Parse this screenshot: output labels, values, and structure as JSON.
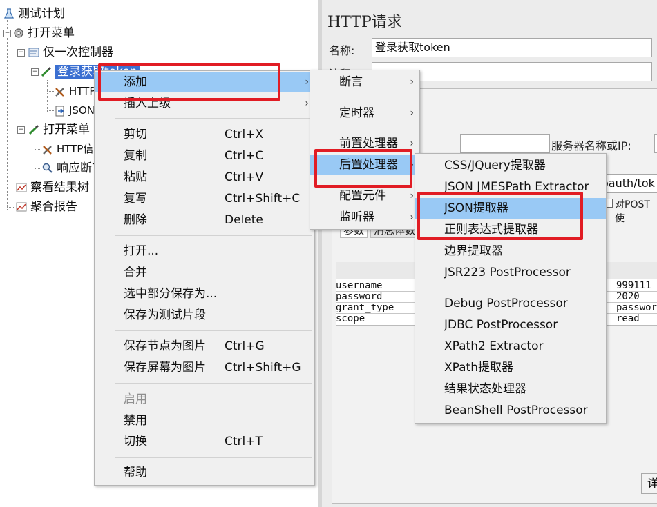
{
  "tree": {
    "nodes": [
      {
        "label": "测试计划"
      },
      {
        "label": "打开菜单"
      },
      {
        "label": "仅一次控制器"
      },
      {
        "label": "登录获取token"
      },
      {
        "label": "HTTP信息头管理器"
      },
      {
        "label": "JSON"
      },
      {
        "label": "打开菜单"
      },
      {
        "label": "HTTP信息头管理器"
      },
      {
        "label": "响应断言"
      },
      {
        "label": "察看结果树"
      },
      {
        "label": "聚合报告"
      }
    ]
  },
  "panel": {
    "title": "HTTP请求",
    "name_label": "名称:",
    "name_value": "登录获取token",
    "comment_label": "注释:",
    "server_label": "服务器名称或IP:",
    "path_value": "oauth/tok",
    "post_label": "对POST使",
    "params_tab": "参数",
    "body_tab": "消息体数",
    "params": [
      {
        "name": "username",
        "value": "999111"
      },
      {
        "name": "password",
        "value": "2020"
      },
      {
        "name": "grant_type",
        "value": "passwor"
      },
      {
        "name": "scope",
        "value": "read"
      }
    ],
    "detail_btn": "详"
  },
  "menu1": {
    "items": [
      {
        "label": "添加",
        "shortcut": "",
        "arrow": "›"
      },
      {
        "label": "插入上级",
        "shortcut": "",
        "arrow": "›"
      },
      {
        "label": "剪切",
        "shortcut": "Ctrl+X"
      },
      {
        "label": "复制",
        "shortcut": "Ctrl+C"
      },
      {
        "label": "粘贴",
        "shortcut": "Ctrl+V"
      },
      {
        "label": "复写",
        "shortcut": "Ctrl+Shift+C"
      },
      {
        "label": "删除",
        "shortcut": "Delete"
      },
      {
        "label": "打开...",
        "shortcut": ""
      },
      {
        "label": "合并",
        "shortcut": ""
      },
      {
        "label": "选中部分保存为...",
        "shortcut": ""
      },
      {
        "label": "保存为测试片段",
        "shortcut": ""
      },
      {
        "label": "保存节点为图片",
        "shortcut": "Ctrl+G"
      },
      {
        "label": "保存屏幕为图片",
        "shortcut": "Ctrl+Shift+G"
      },
      {
        "label": "启用",
        "shortcut": ""
      },
      {
        "label": "禁用",
        "shortcut": ""
      },
      {
        "label": "切换",
        "shortcut": "Ctrl+T"
      },
      {
        "label": "帮助",
        "shortcut": ""
      }
    ]
  },
  "menu2": {
    "items": [
      {
        "label": "断言",
        "arrow": "›"
      },
      {
        "label": "定时器",
        "arrow": "›"
      },
      {
        "label": "前置处理器",
        "arrow": "›"
      },
      {
        "label": "后置处理器",
        "arrow": "›"
      },
      {
        "label": "配置元件",
        "arrow": "›"
      },
      {
        "label": "监听器",
        "arrow": "›"
      }
    ]
  },
  "menu3": {
    "items": [
      {
        "label": "CSS/JQuery提取器"
      },
      {
        "label": "JSON JMESPath Extractor"
      },
      {
        "label": "JSON提取器"
      },
      {
        "label": "正则表达式提取器"
      },
      {
        "label": "边界提取器"
      },
      {
        "label": "JSR223 PostProcessor"
      },
      {
        "label": "Debug PostProcessor"
      },
      {
        "label": "JDBC PostProcessor"
      },
      {
        "label": "XPath2 Extractor"
      },
      {
        "label": "XPath提取器"
      },
      {
        "label": "结果状态处理器"
      },
      {
        "label": "BeanShell PostProcessor"
      }
    ]
  },
  "colors": {
    "highlight": "#99c9f5",
    "selection": "#3b6fd1",
    "annotation_red": "#e11c24"
  }
}
